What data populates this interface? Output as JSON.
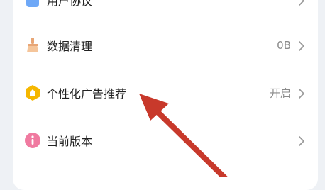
{
  "settings": {
    "items": [
      {
        "label": "用户协议",
        "value": "",
        "icon": "document-icon"
      },
      {
        "label": "数据清理",
        "value": "0B",
        "icon": "broom-icon"
      },
      {
        "label": "个性化广告推荐",
        "value": "开启",
        "icon": "hexagon-badge-icon"
      },
      {
        "label": "当前版本",
        "value": "",
        "icon": "info-icon"
      }
    ]
  },
  "colors": {
    "annotation_arrow": "#c8392b",
    "hexagon": "#f5b700",
    "info": "#f07aa0",
    "broom": "#f0b88a"
  }
}
